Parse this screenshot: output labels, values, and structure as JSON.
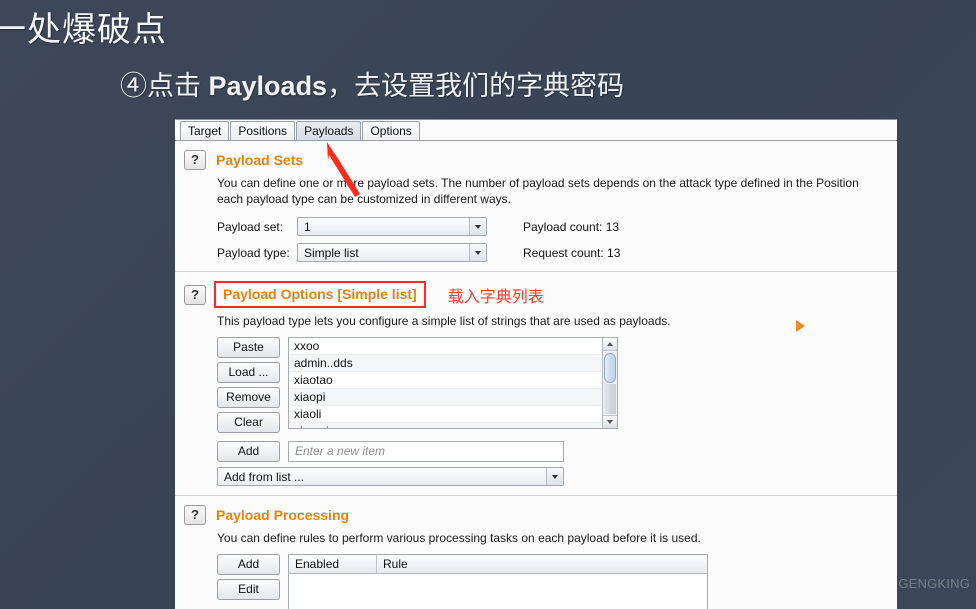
{
  "slide": {
    "title": "一处爆破点",
    "subtitle_prefix": "④点击 ",
    "subtitle_bold": "Payloads",
    "subtitle_suffix": "，去设置我们的字典密码"
  },
  "window": {
    "tabs": [
      {
        "label": "Target",
        "active": false
      },
      {
        "label": "Positions",
        "active": false
      },
      {
        "label": "Payloads",
        "active": true
      },
      {
        "label": "Options",
        "active": false
      }
    ]
  },
  "payload_sets": {
    "help_glyph": "?",
    "title": "Payload Sets",
    "desc_line1": "You can define one or more payload sets. The number of payload sets depends on the attack type defined in the Position",
    "desc_line2": "each payload type can be customized in different ways.",
    "payload_set_label": "Payload set:",
    "payload_set_value": "1",
    "payload_type_label": "Payload type:",
    "payload_type_value": "Simple list",
    "payload_count": "Payload count: 13",
    "request_count": "Request count: 13"
  },
  "payload_options": {
    "help_glyph": "?",
    "title": "Payload Options [Simple list]",
    "annotation_cn": "载入字典列表",
    "desc": "This payload type lets you configure a simple list of strings that are used as payloads.",
    "buttons": [
      {
        "label": "Paste"
      },
      {
        "label": "Load ..."
      },
      {
        "label": "Remove"
      },
      {
        "label": "Clear"
      }
    ],
    "add_button": "Add",
    "new_item_placeholder": "Enter a new item",
    "add_from_list": "Add from list ...",
    "items": [
      "xxoo",
      "admin..dds",
      "xiaotao",
      "xiaopi",
      "xiaoli",
      "xiaoming"
    ]
  },
  "payload_processing": {
    "help_glyph": "?",
    "title": "Payload Processing",
    "desc": "You can define rules to perform various processing tasks on each payload before it is used.",
    "add_button": "Add",
    "edit_button": "Edit",
    "columns": [
      "Enabled",
      "Rule"
    ]
  },
  "watermark": "https://blog.csdn.net/MIGENGKING",
  "colors": {
    "background": "#3b4557",
    "section_title": "#e8820c",
    "annotation_red": "#ff3b30",
    "highlight_box": "#ff2d21",
    "marker_orange": "#f5871f"
  }
}
